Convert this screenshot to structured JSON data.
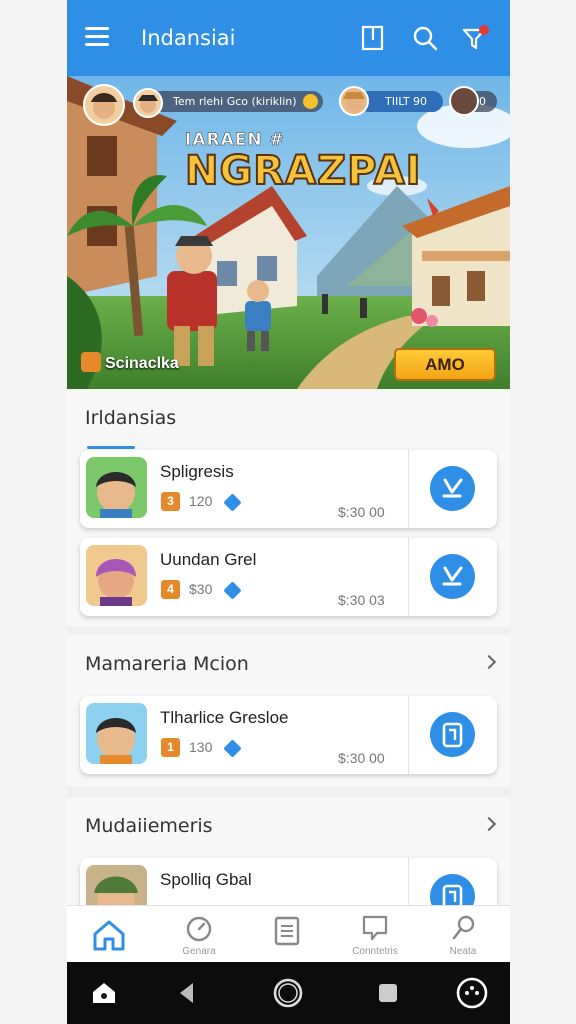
{
  "appbar": {
    "title": "Indansiai",
    "icons": [
      "menu-icon",
      "bookmark-icon",
      "search-icon",
      "filter-icon"
    ]
  },
  "hero": {
    "player_info": "Tem rlehi Gco (kiriklin)",
    "currency": "TIILT 90",
    "currency_count": "0",
    "title_small": "IARAEN #",
    "title_big": "NGRAZPAI",
    "badge_label": "Scinaclka",
    "button_label": "AMO"
  },
  "sections": [
    {
      "title": "Irldansias",
      "items": [
        {
          "name": "Spligresis",
          "level": "3",
          "stat": "120",
          "price": "$:30  00",
          "action_icon": "download-check-icon"
        },
        {
          "name": "Uundan Grel",
          "level": "4",
          "stat": "$30",
          "price": "$:30  03",
          "action_icon": "download-check-icon"
        }
      ]
    },
    {
      "title": "Mamareria Mcion",
      "items": [
        {
          "name": "Tlharlice Gresloe",
          "level": "1",
          "stat": "130",
          "price": "$:30  00",
          "action_icon": "clipboard-icon"
        }
      ]
    },
    {
      "title": "Mudaiiemeris",
      "items": [
        {
          "name": "Spolliq Gbal",
          "level": "",
          "stat": "",
          "price": "",
          "action_icon": "clipboard-icon"
        }
      ]
    }
  ],
  "bottom_nav": [
    {
      "label": "",
      "icon": "home-icon",
      "active": true
    },
    {
      "label": "Genara",
      "icon": "gauge-icon"
    },
    {
      "label": "",
      "icon": "list-icon"
    },
    {
      "label": "Conntetris",
      "icon": "chat-icon"
    },
    {
      "label": "Neata",
      "icon": "search-icon"
    }
  ],
  "colors": {
    "primary": "#2f8fe6",
    "accent": "#e5892a",
    "gold": "#f5c33b"
  }
}
